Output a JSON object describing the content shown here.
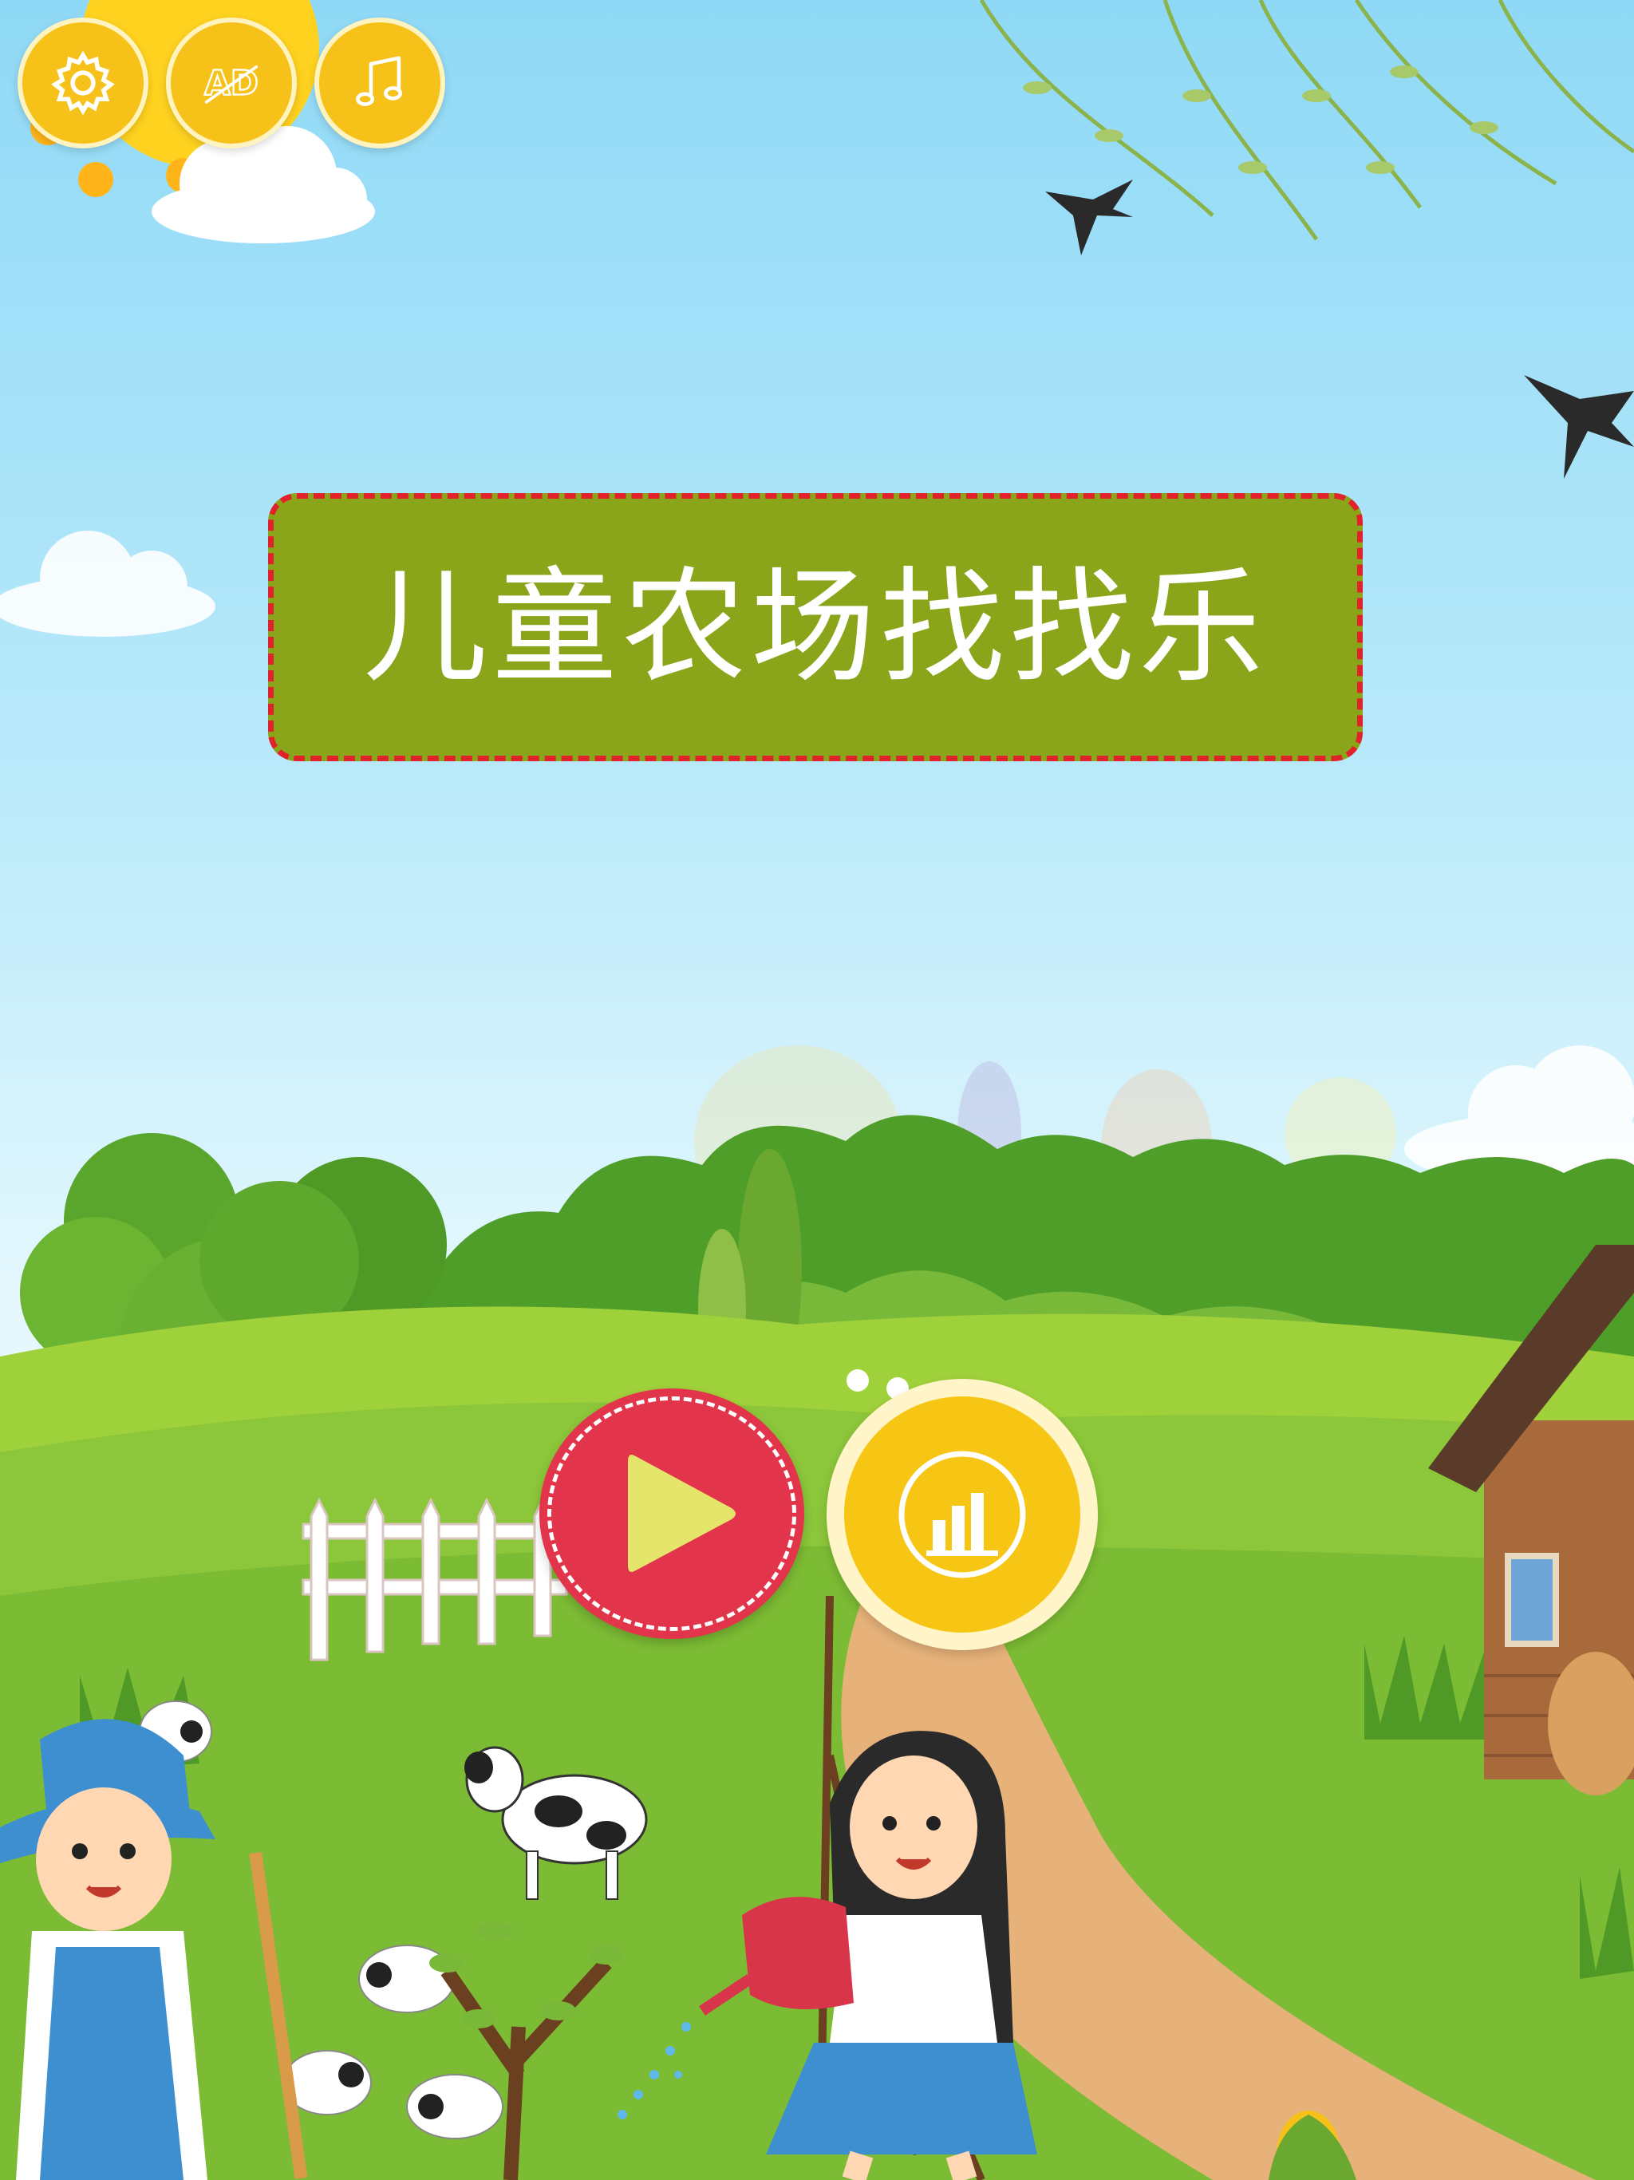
{
  "title": "儿童农场找找乐",
  "top_buttons": [
    {
      "name": "settings-button",
      "icon": "gear-icon"
    },
    {
      "name": "no-ads-button",
      "icon": "ad-icon",
      "label": "AD"
    },
    {
      "name": "music-button",
      "icon": "music-note-icon"
    }
  ],
  "main_buttons": {
    "play": {
      "icon": "play-icon"
    },
    "leaderboard": {
      "icon": "bar-chart-icon"
    }
  },
  "colors": {
    "title_bg": "#8aa51a",
    "title_border": "#e2222a",
    "play_bg": "#e2344a",
    "button_yellow": "#f6c21a"
  }
}
